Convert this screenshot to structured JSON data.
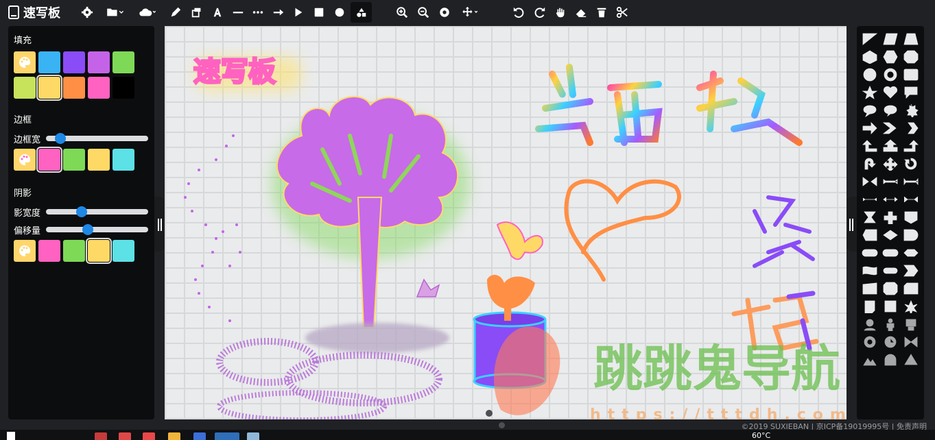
{
  "app": {
    "title": "速写板"
  },
  "left_panel": {
    "fill": {
      "title": "填充",
      "colors": [
        "#ffd66b",
        "#3ab3f5",
        "#8a4cf7",
        "#c563e8",
        "#7ed957",
        "#c7e25b",
        "#ffd966",
        "#ff8f45",
        "#ff62c0",
        "#000000"
      ],
      "selected": 6
    },
    "border": {
      "title": "边框",
      "width_label": "边框宽",
      "width_value": 0.1,
      "colors": [
        "#ff62c0",
        "#7ed957",
        "#ffd966",
        "#5ce1e6"
      ],
      "selected": 0
    },
    "shadow": {
      "title": "阴影",
      "blur_label": "影宽度",
      "blur_value": 0.33,
      "offset_label": "偏移量",
      "offset_value": 0.4,
      "colors": [
        "#ff62c0",
        "#7ed957",
        "#ffd966",
        "#5ce1e6"
      ],
      "selected": 2
    }
  },
  "canvas": {
    "logo_text": "速写板",
    "watermark_text": "跳跳鬼导航",
    "watermark_url": "https://tttdh.com"
  },
  "footer": {
    "text": "©2019 SUXIEBAN | 京ICP备19019995号 | 免责声明"
  },
  "taskbar": {
    "temperature": "60°C"
  },
  "toolbar_icons": [
    "settings-icon",
    "open-folder-icon",
    "cloud-download-icon",
    "pencil-icon",
    "fill-bucket-icon",
    "text-icon",
    "line-icon",
    "dotted-line-icon",
    "arrow-icon",
    "triangle-icon",
    "square-icon",
    "circle-icon",
    "shapes-icon",
    "zoom-in-icon",
    "zoom-out-icon",
    "zoom-reset-icon",
    "pan-icon",
    "undo-icon",
    "redo-icon",
    "hand-icon",
    "eraser-icon",
    "trash-icon",
    "cut-icon"
  ]
}
